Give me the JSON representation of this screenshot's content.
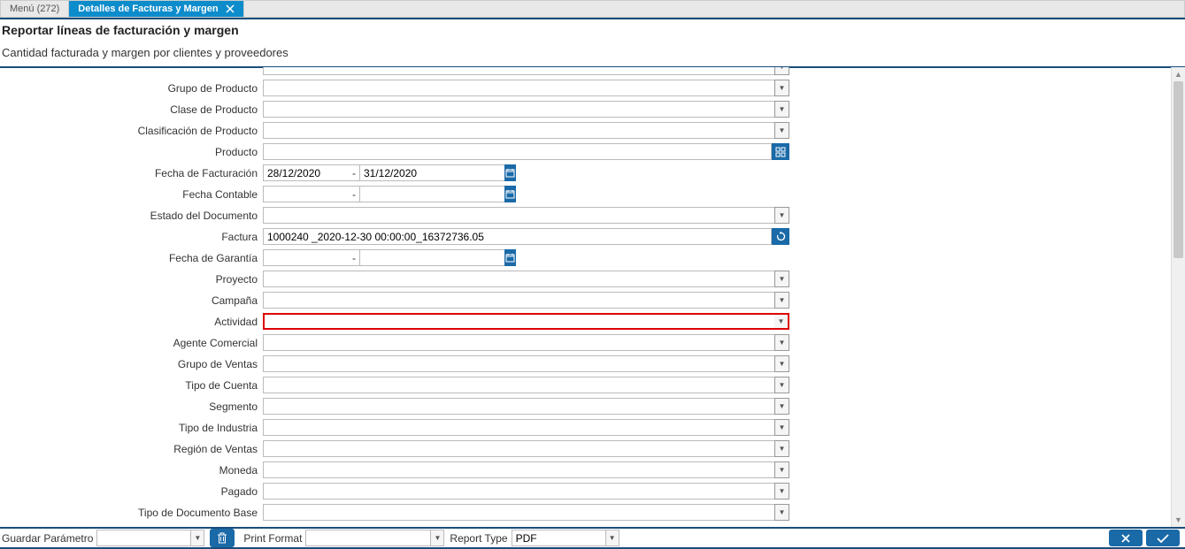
{
  "tabs": {
    "menu_label": "Menú (272)",
    "active_label": "Detalles de Facturas y Margen"
  },
  "header": {
    "title": "Reportar líneas de facturación y margen",
    "subtitle": "Cantidad facturada y margen por clientes y proveedores"
  },
  "fields": {
    "grupo_producto": {
      "label": "Grupo de Producto",
      "value": ""
    },
    "clase_producto": {
      "label": "Clase de Producto",
      "value": ""
    },
    "clasificacion_producto": {
      "label": "Clasificación de Producto",
      "value": ""
    },
    "producto": {
      "label": "Producto",
      "value": ""
    },
    "fecha_facturacion": {
      "label": "Fecha de Facturación",
      "from": "28/12/2020",
      "to": "31/12/2020"
    },
    "fecha_contable": {
      "label": "Fecha Contable",
      "from": "",
      "to": ""
    },
    "estado_documento": {
      "label": "Estado del Documento",
      "value": ""
    },
    "factura": {
      "label": "Factura",
      "value": "1000240 _2020-12-30 00:00:00_16372736.05"
    },
    "fecha_garantia": {
      "label": "Fecha de Garantía",
      "from": "",
      "to": ""
    },
    "proyecto": {
      "label": "Proyecto",
      "value": ""
    },
    "campana": {
      "label": "Campaña",
      "value": ""
    },
    "actividad": {
      "label": "Actividad",
      "value": ""
    },
    "agente_comercial": {
      "label": "Agente Comercial",
      "value": ""
    },
    "grupo_ventas": {
      "label": "Grupo de Ventas",
      "value": ""
    },
    "tipo_cuenta": {
      "label": "Tipo de Cuenta",
      "value": ""
    },
    "segmento": {
      "label": "Segmento",
      "value": ""
    },
    "tipo_industria": {
      "label": "Tipo de Industria",
      "value": ""
    },
    "region_ventas": {
      "label": "Región de Ventas",
      "value": ""
    },
    "moneda": {
      "label": "Moneda",
      "value": ""
    },
    "pagado": {
      "label": "Pagado",
      "value": ""
    },
    "tipo_documento_base": {
      "label": "Tipo de Documento Base",
      "value": ""
    }
  },
  "footer": {
    "guardar_parametro_label": "Guardar Parámetro",
    "guardar_parametro_value": "",
    "print_format_label": "Print Format",
    "print_format_value": "",
    "report_type_label": "Report Type",
    "report_type_value": "PDF"
  }
}
